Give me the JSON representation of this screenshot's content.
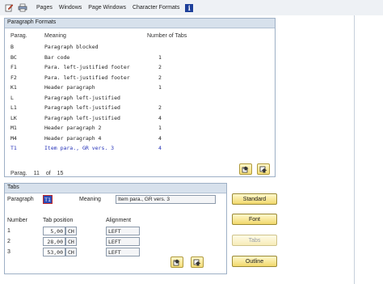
{
  "toolbar": {
    "menu": [
      "Pages",
      "Windows",
      "Page Windows",
      "Character Formats"
    ],
    "icons": [
      "edit-icon",
      "print-icon",
      "info-icon"
    ],
    "info_label": "i"
  },
  "paragraph_formats": {
    "title": "Paragraph Formats",
    "columns": {
      "parag": "Parag.",
      "meaning": "Meaning",
      "tabs": "Number of Tabs"
    },
    "rows": [
      {
        "parag": "B",
        "meaning": "Paragraph blocked",
        "tabs": ""
      },
      {
        "parag": "BC",
        "meaning": "Bar code",
        "tabs": "1"
      },
      {
        "parag": "F1",
        "meaning": "Para. left-justified footer",
        "tabs": "2"
      },
      {
        "parag": "F2",
        "meaning": "Para. left-justified footer",
        "tabs": "2"
      },
      {
        "parag": "K1",
        "meaning": "Header paragraph",
        "tabs": "1"
      },
      {
        "parag": "L",
        "meaning": "Paragraph left-justified",
        "tabs": ""
      },
      {
        "parag": "L1",
        "meaning": "Paragraph left-justified",
        "tabs": "2"
      },
      {
        "parag": "LK",
        "meaning": "Paragraph left-justified",
        "tabs": "4"
      },
      {
        "parag": "M1",
        "meaning": "Header paragraph 2",
        "tabs": "1"
      },
      {
        "parag": "M4",
        "meaning": "Header paragraph 4",
        "tabs": "4"
      },
      {
        "parag": "T1",
        "meaning": "Item para., GR vers. 3",
        "tabs": "4"
      }
    ],
    "selected_index": 10,
    "status": {
      "label": "Parag.",
      "current": "11",
      "of": "of",
      "total": "15"
    }
  },
  "tabs_section": {
    "title": "Tabs",
    "paragraph_label": "Paragraph",
    "paragraph_value": "T1",
    "meaning_label": "Meaning",
    "meaning_value": "Item para., GR vers. 3",
    "columns": {
      "number": "Number",
      "position": "Tab position",
      "alignment": "Alignment"
    },
    "rows": [
      {
        "number": "1",
        "position": "5,00",
        "unit": "CH",
        "alignment": "LEFT"
      },
      {
        "number": "2",
        "position": "28,00",
        "unit": "CH",
        "alignment": "LEFT"
      },
      {
        "number": "3",
        "position": "53,00",
        "unit": "CH",
        "alignment": "LEFT"
      }
    ]
  },
  "buttons": {
    "standard": "Standard",
    "font": "Font",
    "tabs": "Tabs",
    "outline": "Outline"
  }
}
